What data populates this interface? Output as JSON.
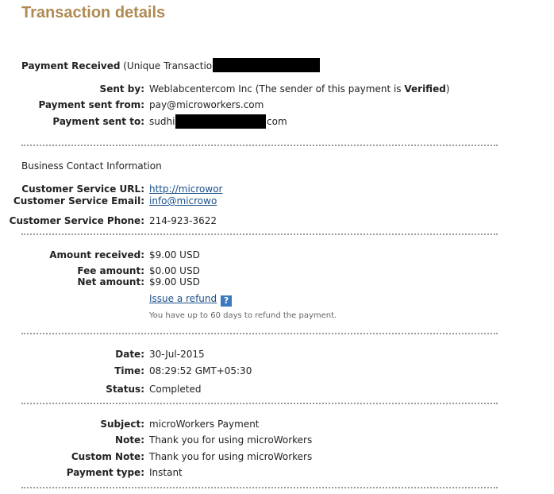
{
  "title": "Transaction details",
  "payment": {
    "received_label": "Payment Received",
    "txn_label": "(Unique Transaction ID",
    "sent_by_label": "Sent by:",
    "sent_by_value": "Weblabcentercom Inc (The sender of this payment is ",
    "verified_text": "Verified",
    "sent_by_close": ")",
    "sent_from_label": "Payment sent from:",
    "sent_from_value": "pay@microworkers.com",
    "sent_to_label": "Payment sent to:",
    "sent_to_prefix": "sudhir",
    "sent_to_suffix": "com"
  },
  "contact": {
    "heading": "Business Contact Information",
    "url_label": "Customer Service URL:",
    "url_value": "http://microwor",
    "email_label": "Customer Service Email:",
    "email_value": "info@microwo",
    "phone_label": "Customer Service Phone:",
    "phone_value": "214-923-3622"
  },
  "amounts": {
    "received_label": "Amount received:",
    "received_value": "$9.00 USD",
    "fee_label": "Fee amount:",
    "fee_value": "$0.00 USD",
    "net_label": "Net amount:",
    "net_value": "$9.00 USD",
    "refund_link": "Issue a refund",
    "refund_help": "?",
    "refund_note": "You have up to 60 days to refund the payment."
  },
  "status": {
    "date_label": "Date:",
    "date_value": "30-Jul-2015",
    "time_label": "Time:",
    "time_value": "08:29:52 GMT+05:30",
    "status_label": "Status:",
    "status_value": "Completed"
  },
  "details": {
    "subject_label": "Subject:",
    "subject_value": "microWorkers Payment",
    "note_label": "Note:",
    "note_value": "Thank you for using microWorkers",
    "custom_note_label": "Custom Note:",
    "custom_note_value": "Thank you for using microWorkers",
    "payment_type_label": "Payment type:",
    "payment_type_value": "Instant"
  }
}
